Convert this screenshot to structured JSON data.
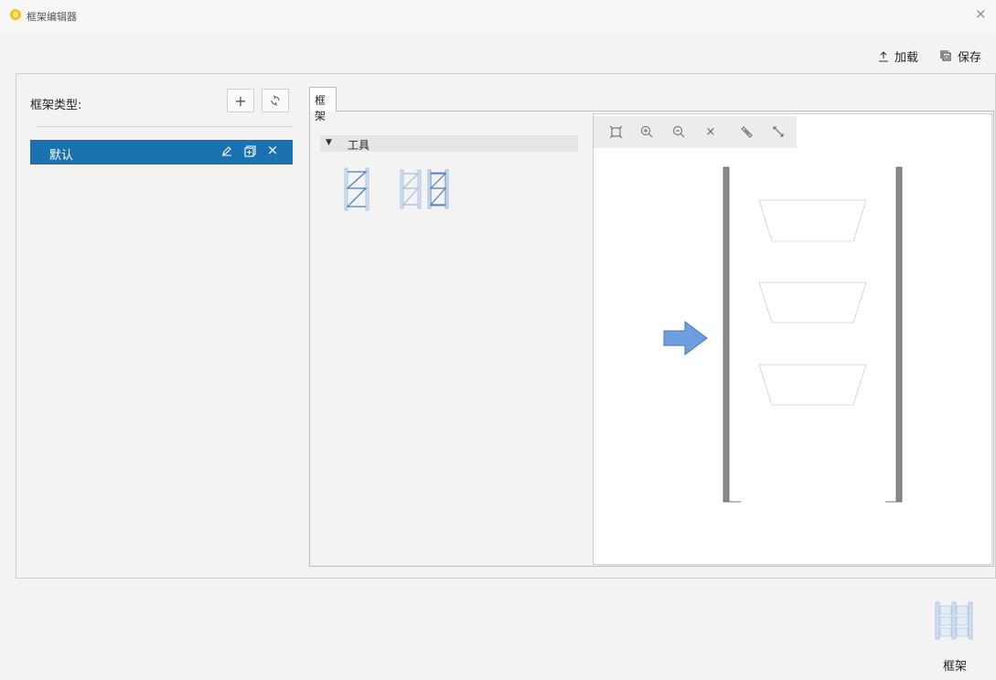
{
  "window": {
    "title": "框架编辑器",
    "close_glyph": "×"
  },
  "toolbar": {
    "load": {
      "label": "加载",
      "icon": "upload-icon"
    },
    "save": {
      "label": "保存",
      "icon": "save-icon"
    }
  },
  "left_panel": {
    "type_label": "框架类型:",
    "add_glyph": "+",
    "refresh_icon": "refresh-icon",
    "types": [
      {
        "label": "默认",
        "selected": true
      }
    ],
    "row_actions": [
      "edit-icon",
      "copy-icon",
      "delete-icon"
    ],
    "delete_glyph": "×"
  },
  "tabs": [
    {
      "label": "框架",
      "active": true
    }
  ],
  "tools": {
    "header": "工具",
    "expanded": true,
    "items": [
      {
        "icon": "single-frame-icon"
      },
      {
        "icon": "double-frame-icon"
      }
    ]
  },
  "canvas_toolbar": [
    {
      "icon": "fit-view-icon"
    },
    {
      "icon": "zoom-in-icon"
    },
    {
      "icon": "zoom-out-icon"
    },
    {
      "icon": "clear-icon",
      "glyph": "×"
    },
    {
      "icon": "rotate-icon"
    },
    {
      "icon": "resize-icon"
    }
  ],
  "bottom": {
    "label": "框架",
    "icon": "frame-preview-icon"
  },
  "colors": {
    "accent": "#1a73b0",
    "arrow_fill": "#6c9ee0",
    "upright": "#8a8a8a",
    "app_icon": "#f5c518"
  }
}
